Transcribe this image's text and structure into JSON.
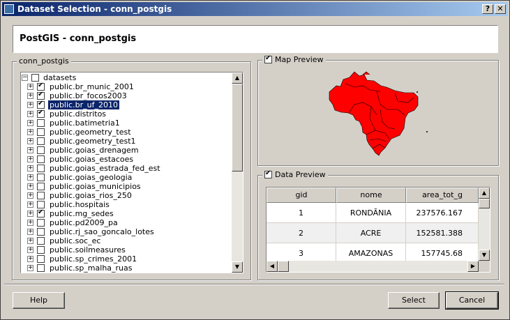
{
  "window": {
    "title": "Dataset Selection - conn_postgis",
    "help_btn": "?",
    "close_btn": "✕"
  },
  "header": {
    "title": "PostGIS - conn_postgis"
  },
  "connection_group": {
    "label": "conn_postgis"
  },
  "tree": {
    "root": "datasets",
    "items": [
      {
        "label": "public.br_munic_2001",
        "checked": true
      },
      {
        "label": "public.br_focos2003",
        "checked": true
      },
      {
        "label": "public.br_uf_2010",
        "checked": true,
        "selected": true
      },
      {
        "label": "public.distritos",
        "checked": true
      },
      {
        "label": "public.batimetria1",
        "checked": false
      },
      {
        "label": "public.geometry_test",
        "checked": false
      },
      {
        "label": "public.geometry_test1",
        "checked": false
      },
      {
        "label": "public.goias_drenagem",
        "checked": false
      },
      {
        "label": "public.goias_estacoes",
        "checked": false
      },
      {
        "label": "public.goias_estrada_fed_est",
        "checked": false
      },
      {
        "label": "public.goias_geologia",
        "checked": false
      },
      {
        "label": "public.goias_municipios",
        "checked": false
      },
      {
        "label": "public.goias_rios_250",
        "checked": false
      },
      {
        "label": "public.hospitais",
        "checked": false
      },
      {
        "label": "public.mg_sedes",
        "checked": true
      },
      {
        "label": "public.pd2009_pa",
        "checked": false
      },
      {
        "label": "public.rj_sao_goncalo_lotes",
        "checked": false
      },
      {
        "label": "public.soc_ec",
        "checked": false
      },
      {
        "label": "public.soilmeasures",
        "checked": false
      },
      {
        "label": "public.sp_crimes_2001",
        "checked": false
      },
      {
        "label": "public.sp_malha_ruas",
        "checked": false
      }
    ]
  },
  "map_preview": {
    "label": "Map Preview",
    "checked": true,
    "fill_color": "#ff0000"
  },
  "data_preview": {
    "label": "Data Preview",
    "checked": true,
    "columns": [
      "gid",
      "nome",
      "area_tot_g"
    ],
    "rows": [
      [
        "1",
        "RONDÃNIA",
        "237576.167"
      ],
      [
        "2",
        "ACRE",
        "152581.388"
      ],
      [
        "3",
        "AMAZONAS",
        "157745.68"
      ]
    ]
  },
  "buttons": {
    "help": "Help",
    "select": "Select",
    "cancel": "Cancel"
  }
}
